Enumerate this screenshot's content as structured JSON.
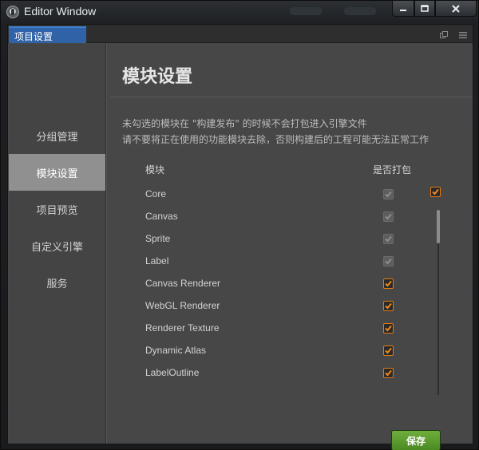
{
  "window": {
    "title": "Editor Window",
    "controls": {
      "minimize": "minimize-icon",
      "maximize": "maximize-icon",
      "close": "close-icon"
    }
  },
  "tabs": [
    {
      "label": "项目设置",
      "active": true
    }
  ],
  "sidebar": {
    "items": [
      {
        "label": "分组管理",
        "active": false
      },
      {
        "label": "模块设置",
        "active": true
      },
      {
        "label": "项目预览",
        "active": false
      },
      {
        "label": "自定义引擎",
        "active": false
      },
      {
        "label": "服务",
        "active": false
      }
    ]
  },
  "main": {
    "title": "模块设置",
    "description_line1": "未勾选的模块在 \"构建发布\" 的时候不会打包进入引擎文件",
    "description_line2": "请不要将正在使用的功能模块去除，否则构建后的工程可能无法正常工作",
    "table": {
      "col_module": "模块",
      "col_pack": "是否打包",
      "header_checked": true,
      "rows": [
        {
          "name": "Core",
          "checked": true,
          "disabled": true
        },
        {
          "name": "Canvas",
          "checked": true,
          "disabled": true
        },
        {
          "name": "Sprite",
          "checked": true,
          "disabled": true
        },
        {
          "name": "Label",
          "checked": true,
          "disabled": true
        },
        {
          "name": "Canvas Renderer",
          "checked": true,
          "disabled": false
        },
        {
          "name": "WebGL Renderer",
          "checked": true,
          "disabled": false
        },
        {
          "name": "Renderer Texture",
          "checked": true,
          "disabled": false
        },
        {
          "name": "Dynamic Atlas",
          "checked": true,
          "disabled": false
        },
        {
          "name": "LabelOutline",
          "checked": true,
          "disabled": false
        }
      ]
    },
    "save_label": "保存"
  },
  "colors": {
    "accent_orange": "#e07a14",
    "tab_blue": "#2f62a6",
    "save_green": "#5c9c2e"
  }
}
